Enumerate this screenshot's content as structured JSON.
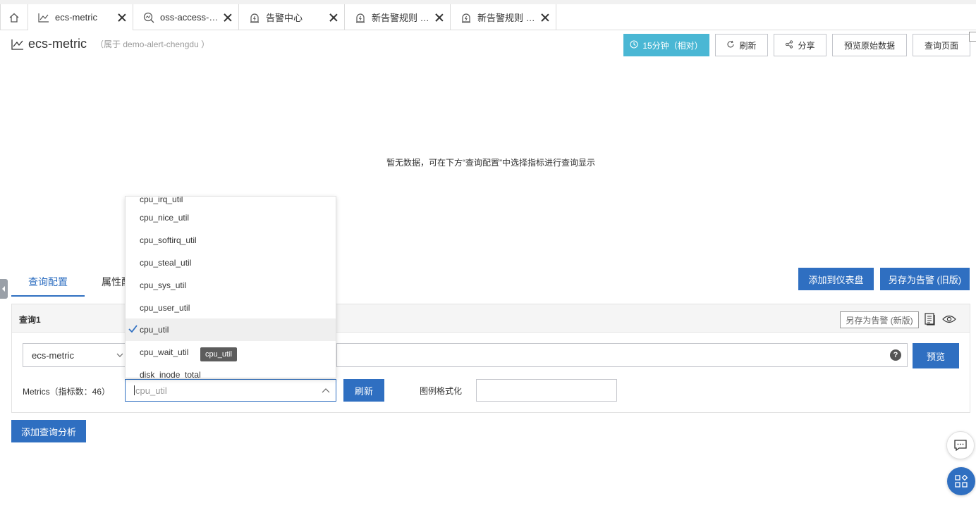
{
  "tabs": [
    {
      "label": "ecs-metric",
      "icon": "line-chart-icon"
    },
    {
      "label": "oss-access-log",
      "icon": "search-chart-icon"
    },
    {
      "label": "告警中心",
      "icon": "alarm-bell-icon"
    },
    {
      "label": "新告警规则 C...",
      "icon": "alarm-bell-icon"
    },
    {
      "label": "新告警规则 O...",
      "icon": "alarm-bell-icon"
    }
  ],
  "header": {
    "title": "ecs-metric",
    "subtitle": "（属于 demo-alert-chengdu ）",
    "time_button": "15分钟（相对）",
    "refresh_button": "刷新",
    "share_button": "分享",
    "preview_raw_button": "预览原始数据",
    "query_page_button": "查询页面"
  },
  "empty_message": "暂无数据，可在下方“查询配置”中选择指标进行查询显示",
  "subtabs": {
    "query_config": "查询配置",
    "attribute_config": "属性配"
  },
  "actions": {
    "add_to_dashboard": "添加到仪表盘",
    "save_as_alert_old": "另存为告警 (旧版)",
    "add_query_analysis": "添加查询分析"
  },
  "query": {
    "title": "查询1",
    "save_as_alert_new": "另存为告警 (新版)",
    "store_value": "ecs-metric",
    "preview_button": "预览",
    "metrics_label": "Metrics（指标数：46）",
    "metric_value": "cpu_util",
    "refresh_button": "刷新",
    "legend_label": "图例格式化",
    "legend_value": ""
  },
  "dropdown": {
    "partial_top": "cpu_irq_util",
    "options": [
      "cpu_nice_util",
      "cpu_softirq_util",
      "cpu_steal_util",
      "cpu_sys_util",
      "cpu_user_util",
      "cpu_util",
      "cpu_wait_util",
      "disk_inode_total"
    ],
    "selected": "cpu_util",
    "tooltip": "cpu_util"
  },
  "colors": {
    "primary": "#2f6fc1",
    "time_button": "#4ab7d4"
  }
}
